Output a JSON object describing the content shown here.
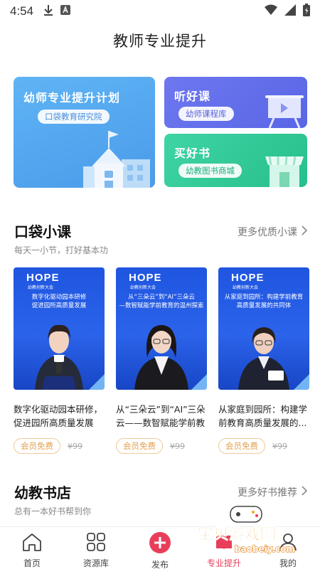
{
  "status_bar": {
    "time": "4:54"
  },
  "page_title": "教师专业提升",
  "banners": {
    "plan": {
      "title": "幼师专业提升计划",
      "pill": "口袋教育研究院"
    },
    "listen": {
      "title": "听好课",
      "pill": "幼师课程库"
    },
    "books": {
      "title": "买好书",
      "pill": "幼教图书商城"
    }
  },
  "courses_section": {
    "title": "口袋小课",
    "subtitle": "每天一小节，打好基本功",
    "more": "更多优质小课"
  },
  "courses": [
    {
      "logo": "HOPE",
      "logo_sub": "幼教创新大会",
      "thumb_text": "数字化驱动园本研修\n促进园所高质量发展",
      "title": "数字化驱动园本研修，促进园所高质量发展",
      "badge": "会员免费",
      "price": "¥99"
    },
    {
      "logo": "HOPE",
      "logo_sub": "幼教创新大会",
      "thumb_text": "从“三朵云”到“AI”三朵云\n—数智赋能学前教育的温州探索",
      "title": "从“三朵云”到“AI”三朵云——数智赋能学前教育...",
      "badge": "会员免费",
      "price": "¥99"
    },
    {
      "logo": "HOPE",
      "logo_sub": "幼教创新大会",
      "thumb_text": "从家庭到园所：构建学前教育\n高质量发展的共同体",
      "title": "从家庭到园所：构建学前教育高质量发展的...",
      "badge": "会员免费",
      "price": "¥99"
    }
  ],
  "books_section": {
    "title": "幼教书店",
    "subtitle": "总有一本好书帮到你",
    "more": "更多好书推荐"
  },
  "tab_bar": [
    {
      "label": "首页",
      "icon": "home-icon"
    },
    {
      "label": "资源库",
      "icon": "grid-icon"
    },
    {
      "label": "发布",
      "icon": "plus-circle-icon"
    },
    {
      "label": "专业提升",
      "icon": "book-icon"
    },
    {
      "label": "我的",
      "icon": "user-icon"
    }
  ],
  "watermark": {
    "text": "宝贝游戏网",
    "url": "baobeiy.com"
  },
  "colors": {
    "accent": "#e83e5a",
    "plan": "#4a9be9",
    "listen": "#5a66e6",
    "books": "#27bf8c",
    "badge": "#e2a152"
  }
}
